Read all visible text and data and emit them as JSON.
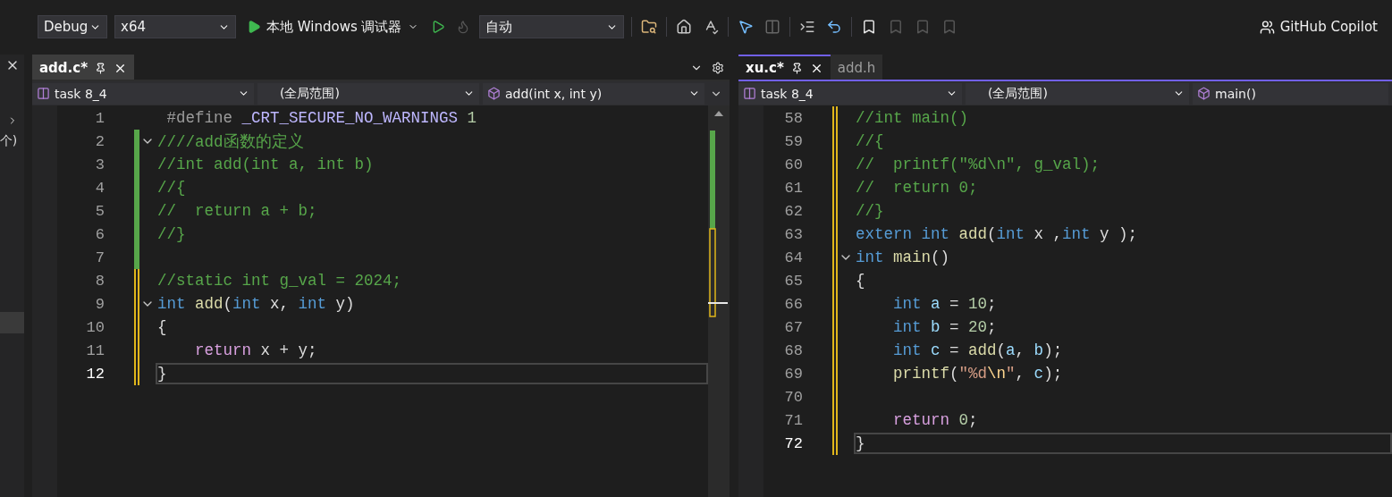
{
  "toolbar": {
    "configuration": "Debug",
    "platform": "x64",
    "run_label": "本地 Windows 调试器",
    "mode": "自动",
    "copilot": "GitHub Copilot"
  },
  "sidebar": {
    "text": "个)"
  },
  "panes": [
    {
      "focused": false,
      "tabs": [
        {
          "label": "add.c*",
          "selected": true,
          "pinnable": true
        }
      ],
      "nav": {
        "project": "task 8_4",
        "scope": "(全局范围)",
        "member": "add(int x, int y)"
      },
      "lines": [
        {
          "number": "1",
          "tokens": [
            {
              "kind": "pp",
              "text": " #define"
            },
            {
              "kind": "macro",
              "text": " _CRT_SECURE_NO_WARNINGS"
            },
            {
              "kind": "num",
              "text": " 1"
            }
          ]
        },
        {
          "number": "2",
          "changed": true,
          "saved": true,
          "fold": true,
          "tokens": [
            {
              "kind": "cm",
              "text": "////add函数的定义"
            }
          ]
        },
        {
          "number": "3",
          "changed": true,
          "saved": true,
          "tokens": [
            {
              "kind": "cm",
              "text": "//int add(int a, int b)"
            }
          ]
        },
        {
          "number": "4",
          "changed": true,
          "saved": true,
          "tokens": [
            {
              "kind": "cm",
              "text": "//{"
            }
          ]
        },
        {
          "number": "5",
          "changed": true,
          "saved": true,
          "tokens": [
            {
              "kind": "cm",
              "text": "//  return a + b;"
            }
          ]
        },
        {
          "number": "6",
          "changed": true,
          "saved": true,
          "tokens": [
            {
              "kind": "cm",
              "text": "//}"
            }
          ]
        },
        {
          "number": "7",
          "changed": true,
          "saved": true
        },
        {
          "number": "8",
          "changed": true,
          "saved": false,
          "tokens": [
            {
              "kind": "cm",
              "text": "//static int g_val = 2024;"
            }
          ]
        },
        {
          "number": "9",
          "changed": true,
          "saved": false,
          "fold": true,
          "tokens": [
            {
              "kind": "kw",
              "text": "int"
            },
            {
              "kind": "fn",
              "text": " add"
            },
            {
              "kind": "pl",
              "text": "("
            },
            {
              "kind": "kw",
              "text": "int"
            },
            {
              "kind": "pl",
              "text": " x, "
            },
            {
              "kind": "kw",
              "text": "int"
            },
            {
              "kind": "pl",
              "text": " y)"
            }
          ]
        },
        {
          "number": "10",
          "changed": true,
          "saved": false,
          "tokens": [
            {
              "kind": "pl",
              "text": "{"
            }
          ]
        },
        {
          "number": "11",
          "changed": true,
          "saved": false,
          "tokens": [
            {
              "kind": "ctl",
              "text": "    return"
            },
            {
              "kind": "pl",
              "text": " x + y;"
            }
          ]
        },
        {
          "number": "12",
          "changed": true,
          "saved": false,
          "current": true,
          "tokens": [
            {
              "kind": "pl",
              "text": "}"
            }
          ]
        }
      ]
    },
    {
      "focused": true,
      "tabs": [
        {
          "label": "xu.c*",
          "selected": true,
          "pinnable": true
        },
        {
          "label": "add.h",
          "selected": false
        }
      ],
      "nav": {
        "project": "task 8_4",
        "scope": "(全局范围)",
        "member": "main()"
      },
      "lines": [
        {
          "number": "58",
          "changed": true,
          "saved": false,
          "tokens": [
            {
              "kind": "cm",
              "text": "//int main()"
            }
          ]
        },
        {
          "number": "59",
          "changed": true,
          "saved": false,
          "tokens": [
            {
              "kind": "cm",
              "text": "//{"
            }
          ]
        },
        {
          "number": "60",
          "changed": true,
          "saved": false,
          "tokens": [
            {
              "kind": "cm",
              "text": "//  printf(\"%d\\n\", g_val);"
            }
          ]
        },
        {
          "number": "61",
          "changed": true,
          "saved": false,
          "tokens": [
            {
              "kind": "cm",
              "text": "//  return 0;"
            }
          ]
        },
        {
          "number": "62",
          "changed": true,
          "saved": false,
          "tokens": [
            {
              "kind": "cm",
              "text": "//}"
            }
          ]
        },
        {
          "number": "63",
          "changed": true,
          "saved": false,
          "tokens": [
            {
              "kind": "kw",
              "text": "extern int"
            },
            {
              "kind": "fn",
              "text": " add"
            },
            {
              "kind": "pl",
              "text": "("
            },
            {
              "kind": "kw",
              "text": "int"
            },
            {
              "kind": "pl",
              "text": " x ,"
            },
            {
              "kind": "kw",
              "text": "int"
            },
            {
              "kind": "pl",
              "text": " y );"
            }
          ]
        },
        {
          "number": "64",
          "changed": true,
          "saved": false,
          "fold": true,
          "tokens": [
            {
              "kind": "kw",
              "text": "int"
            },
            {
              "kind": "fn",
              "text": " main"
            },
            {
              "kind": "pl",
              "text": "()"
            }
          ]
        },
        {
          "number": "65",
          "changed": true,
          "saved": false,
          "tokens": [
            {
              "kind": "pl",
              "text": "{"
            }
          ]
        },
        {
          "number": "66",
          "changed": true,
          "saved": false,
          "tokens": [
            {
              "kind": "kw",
              "text": "    int"
            },
            {
              "kind": "var",
              "text": " a"
            },
            {
              "kind": "pl",
              "text": " = "
            },
            {
              "kind": "num",
              "text": "10"
            },
            {
              "kind": "pl",
              "text": ";"
            }
          ]
        },
        {
          "number": "67",
          "changed": true,
          "saved": false,
          "tokens": [
            {
              "kind": "kw",
              "text": "    int"
            },
            {
              "kind": "var",
              "text": " b"
            },
            {
              "kind": "pl",
              "text": " = "
            },
            {
              "kind": "num",
              "text": "20"
            },
            {
              "kind": "pl",
              "text": ";"
            }
          ]
        },
        {
          "number": "68",
          "changed": true,
          "saved": false,
          "tokens": [
            {
              "kind": "kw",
              "text": "    int"
            },
            {
              "kind": "var",
              "text": " c"
            },
            {
              "kind": "pl",
              "text": " = "
            },
            {
              "kind": "fn",
              "text": "add"
            },
            {
              "kind": "pl",
              "text": "("
            },
            {
              "kind": "var",
              "text": "a"
            },
            {
              "kind": "pl",
              "text": ", "
            },
            {
              "kind": "var",
              "text": "b"
            },
            {
              "kind": "pl",
              "text": ");"
            }
          ]
        },
        {
          "number": "69",
          "changed": true,
          "saved": false,
          "tokens": [
            {
              "kind": "fn",
              "text": "    printf"
            },
            {
              "kind": "pl",
              "text": "("
            },
            {
              "kind": "str",
              "text": "\"%d"
            },
            {
              "kind": "esc",
              "text": "\\n"
            },
            {
              "kind": "str",
              "text": "\""
            },
            {
              "kind": "pl",
              "text": ", "
            },
            {
              "kind": "var",
              "text": "c"
            },
            {
              "kind": "pl",
              "text": ");"
            }
          ]
        },
        {
          "number": "70",
          "changed": true,
          "saved": false
        },
        {
          "number": "71",
          "changed": true,
          "saved": false,
          "tokens": [
            {
              "kind": "ctl",
              "text": "    return"
            },
            {
              "kind": "num",
              "text": " 0"
            },
            {
              "kind": "pl",
              "text": ";"
            }
          ]
        },
        {
          "number": "72",
          "changed": true,
          "saved": false,
          "current": true,
          "tokens": [
            {
              "kind": "pl",
              "text": "}"
            }
          ]
        }
      ]
    }
  ]
}
